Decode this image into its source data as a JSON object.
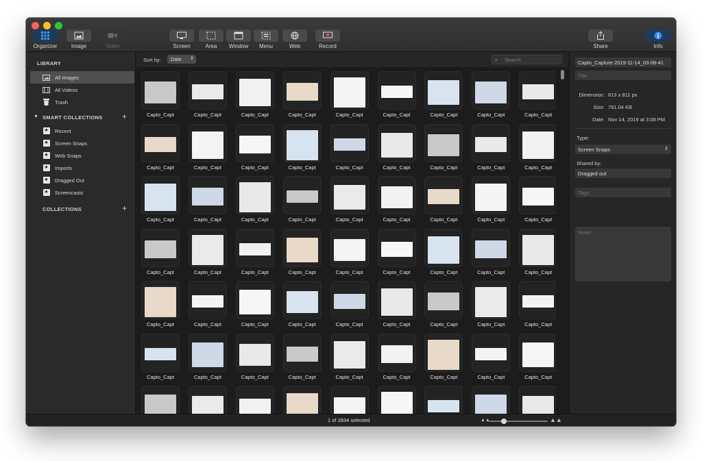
{
  "toolbar": {
    "left": [
      {
        "label": "Organizer",
        "icon": "grid-icon",
        "active": true
      },
      {
        "label": "Image",
        "icon": "image-icon",
        "active": false
      },
      {
        "label": "Video",
        "icon": "video-camera-icon",
        "disabled": true
      }
    ],
    "capture": [
      {
        "label": "Screen",
        "icon": "monitor-icon"
      },
      {
        "label": "Area",
        "icon": "area-select-icon"
      },
      {
        "label": "Window",
        "icon": "window-icon"
      },
      {
        "label": "Menu",
        "icon": "menu-capture-icon"
      },
      {
        "label": "Web",
        "icon": "globe-icon"
      },
      {
        "label": "Record",
        "icon": "record-icon"
      }
    ],
    "share": {
      "label": "Share",
      "icon": "share-icon"
    },
    "info": {
      "label": "Info",
      "icon": "info-icon"
    }
  },
  "sidebar": {
    "library_heading": "LIBRARY",
    "library": [
      {
        "label": "All Images",
        "icon": "image-icon",
        "selected": true
      },
      {
        "label": "All Videos",
        "icon": "film-icon",
        "selected": false
      },
      {
        "label": "Trash",
        "icon": "trash-icon",
        "selected": false
      }
    ],
    "smart_heading": "SMART COLLECTIONS",
    "smart": [
      {
        "label": "Recent"
      },
      {
        "label": "Screen Snaps"
      },
      {
        "label": "Web Snaps"
      },
      {
        "label": "Imports"
      },
      {
        "label": "Dragged Out"
      },
      {
        "label": "Screencasts"
      }
    ],
    "collections_heading": "COLLECTIONS",
    "add_symbol": "+"
  },
  "main": {
    "sort_label": "Sort by:",
    "sort_value": "Date",
    "search_placeholder": "Search",
    "thumb_caption": "Capto_Capt",
    "thumb_colors": [
      "#c9c9c9",
      "#eaeaea",
      "#f2f2f2",
      "#e8d9c8",
      "#f4f4f4",
      "#f6f6f6",
      "#d8e3f0",
      "#cfd8e6",
      "#e9e9e9"
    ]
  },
  "info": {
    "name_value": "Capto_Capture 2019-11-14_03-08-41",
    "title_placeholder": "Title",
    "dimension_label": "Dimension:",
    "dimension_value": "613 x 811 px",
    "size_label": "Size:",
    "size_value": "791.04 KB",
    "date_label": "Date:",
    "date_value": "Nov 14, 2019 at 3:08 PM",
    "type_label": "Type:",
    "type_value": "Screen Snaps",
    "shared_label": "Shared by:",
    "shared_value": "Dragged out",
    "tags_placeholder": "Tags",
    "notes_placeholder": "Notes"
  },
  "status": {
    "selection_text": "1 of 2834 selected",
    "zoom_level": 0.25
  }
}
